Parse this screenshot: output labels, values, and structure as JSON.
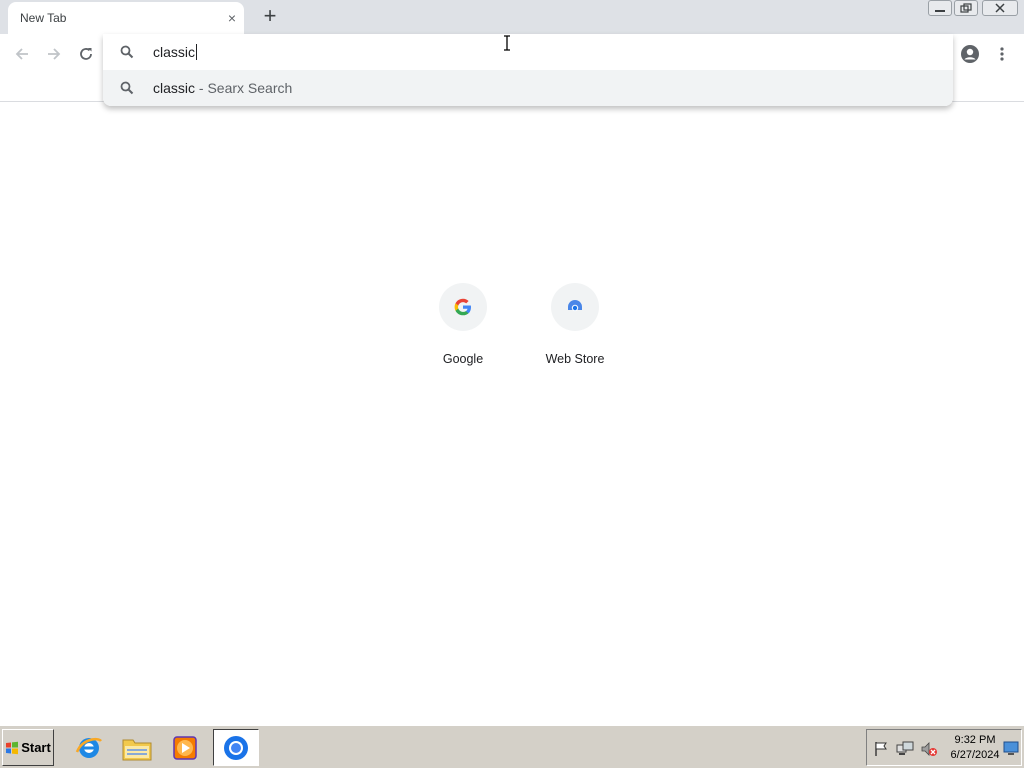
{
  "browser": {
    "tab": {
      "title": "New Tab",
      "close_glyph": "×"
    },
    "new_tab_glyph": "+",
    "window_controls": [
      "minimize-icon",
      "restore-icon",
      "close-icon"
    ]
  },
  "toolbar": {
    "back_icon": "arrow-left-icon",
    "forward_icon": "arrow-right-icon",
    "reload_icon": "reload-icon",
    "profile_icon": "account-circle-icon",
    "menu_icon": "kebab-menu-icon"
  },
  "omnibox": {
    "input_value": "classic",
    "suggestions": [
      {
        "query": "classic",
        "separator": " - ",
        "engine": "Searx Search"
      }
    ]
  },
  "ntp": {
    "shortcuts": [
      {
        "label": "Google",
        "icon": "google-g-icon"
      },
      {
        "label": "Web Store",
        "icon": "web-store-icon"
      }
    ]
  },
  "taskbar": {
    "start_label": "Start",
    "apps": [
      "internet-explorer-icon",
      "file-explorer-icon",
      "media-player-icon",
      "chrome-icon"
    ],
    "clock": {
      "time": "9:32 PM",
      "date": "6/27/2024"
    },
    "tray_icons": [
      "action-center-flag-icon",
      "network-icon",
      "volume-muted-icon",
      "show-desktop-icon"
    ]
  },
  "colors": {
    "tabstrip_bg": "#dee1e6",
    "suggestion_bg": "#f1f3f4",
    "taskbar_bg": "#d4d0c8"
  }
}
